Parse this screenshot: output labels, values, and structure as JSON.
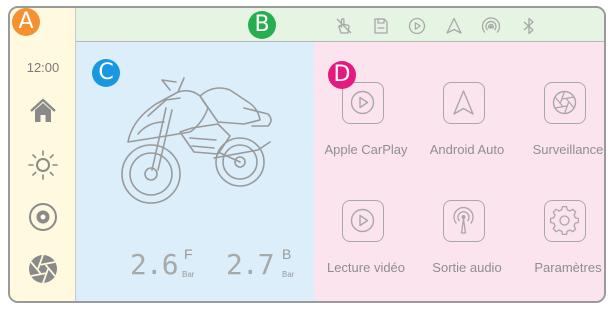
{
  "badges": {
    "a": {
      "letter": "A",
      "color": "#f5922f"
    },
    "b": {
      "letter": "B",
      "color": "#27ae4f"
    },
    "c": {
      "letter": "C",
      "color": "#1798e0"
    },
    "d": {
      "letter": "D",
      "color": "#e5197e"
    }
  },
  "sidebar": {
    "clock": "12:00",
    "items": [
      {
        "icon": "home-icon"
      },
      {
        "icon": "brightness-icon"
      },
      {
        "icon": "disc-icon"
      },
      {
        "icon": "aperture-icon"
      }
    ]
  },
  "status_bar": {
    "icons": [
      "no-touch-icon",
      "sd-card-icon",
      "carplay-icon",
      "android-auto-icon",
      "wireless-icon",
      "bluetooth-icon"
    ]
  },
  "tire_pressure": {
    "front": {
      "value": "2.6",
      "position": "F",
      "unit": "Bar"
    },
    "back": {
      "value": "2.7",
      "position": "B",
      "unit": "Bar"
    }
  },
  "apps": [
    {
      "label": "Apple CarPlay",
      "icon": "carplay-icon"
    },
    {
      "label": "Android Auto",
      "icon": "android-auto-icon"
    },
    {
      "label": "Surveillance",
      "icon": "aperture-icon"
    },
    {
      "label": "Lecture vidéo",
      "icon": "video-play-icon"
    },
    {
      "label": "Sortie audio",
      "icon": "audio-output-icon"
    },
    {
      "label": "Paramètres",
      "icon": "settings-icon"
    }
  ],
  "colors": {
    "sidebar_bg": "#fff9e0",
    "topbar_bg": "#e6f4e4",
    "zone_c_bg": "#ddeefb",
    "zone_d_bg": "#fce4ef",
    "icon_gray": "#a8a8a8"
  }
}
